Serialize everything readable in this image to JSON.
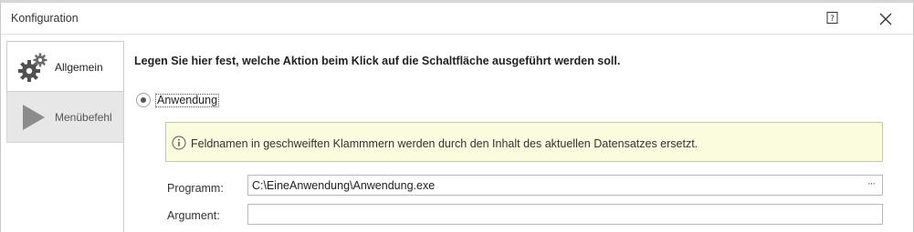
{
  "window": {
    "title": "Konfiguration",
    "help_icon": "help-question-icon",
    "close_icon": "close-icon"
  },
  "tabs": [
    {
      "label": "Allgemein",
      "icon": "gears-icon",
      "active": true
    },
    {
      "label": "Menübefehl",
      "icon": "play-icon",
      "active": false
    }
  ],
  "main": {
    "heading": "Legen Sie hier fest, welche Aktion beim Klick auf die Schaltfläche ausgeführt werden soll.",
    "radio_label": "Anwendung",
    "radio_selected": true,
    "info_text": "Feldnamen in geschweiften Klammmern werden durch den Inhalt des aktuellen Datensatzes ersetzt.",
    "fields": {
      "programm_label": "Programm:",
      "programm_value": "C:\\EineAnwendung\\Anwendung.exe",
      "programm_button": "···",
      "argument_label": "Argument:",
      "argument_value": ""
    }
  },
  "colors": {
    "info_background": "#fbfbdd",
    "info_border": "#c9c9a4",
    "inactive_tab": "#e7e7e7"
  }
}
